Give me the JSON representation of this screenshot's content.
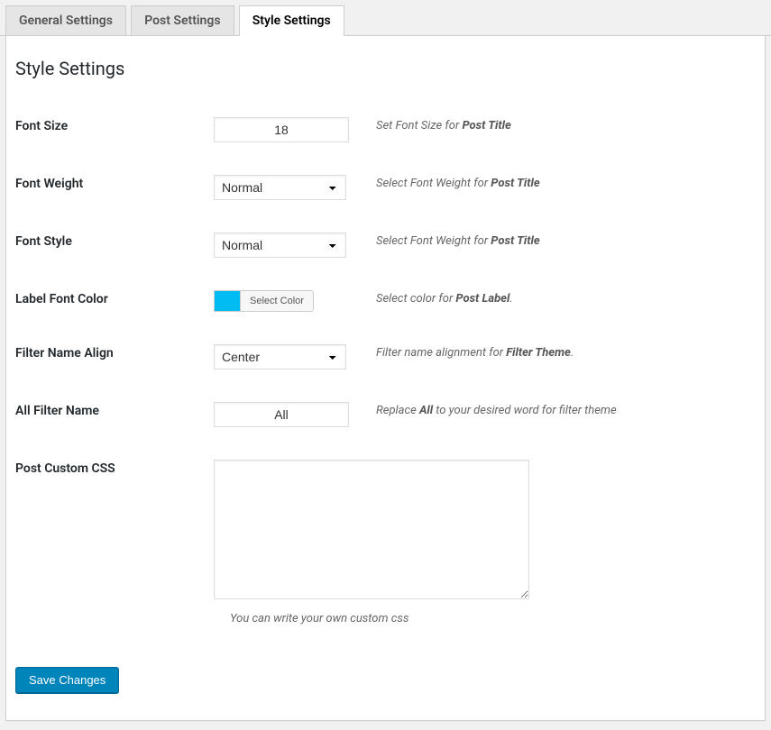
{
  "tabs": [
    {
      "label": "General Settings",
      "active": false
    },
    {
      "label": "Post Settings",
      "active": false
    },
    {
      "label": "Style Settings",
      "active": true
    }
  ],
  "heading": "Style Settings",
  "fields": {
    "font_size": {
      "label": "Font Size",
      "value": "18",
      "desc_pre": "Set Font Size for ",
      "desc_bold": "Post Title"
    },
    "font_weight": {
      "label": "Font Weight",
      "value": "Normal",
      "desc_pre": "Select Font Weight for ",
      "desc_bold": "Post Title"
    },
    "font_style": {
      "label": "Font Style",
      "value": "Normal",
      "desc_pre": "Select Font Weight for ",
      "desc_bold": "Post Title"
    },
    "label_color": {
      "label": "Label Font Color",
      "button": "Select Color",
      "swatch": "#00bcf2",
      "desc_pre": "Select color for ",
      "desc_bold": "Post Label",
      "desc_post": "."
    },
    "filter_align": {
      "label": "Filter Name Align",
      "value": "Center",
      "desc_pre": "Filter name alignment for ",
      "desc_bold": "Filter Theme",
      "desc_post": "."
    },
    "all_filter": {
      "label": "All Filter Name",
      "value": "All",
      "desc_pre": "Replace ",
      "desc_bold": "All",
      "desc_post": " to your desired word for filter theme"
    },
    "custom_css": {
      "label": "Post Custom CSS",
      "value": "",
      "below": "You can write your own custom css"
    }
  },
  "submit": "Save Changes"
}
